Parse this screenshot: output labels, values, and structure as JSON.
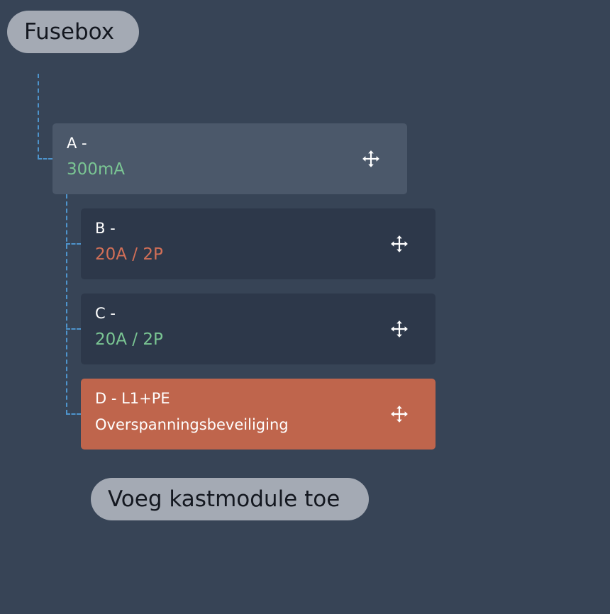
{
  "root": {
    "label": "Fusebox"
  },
  "modules": [
    {
      "title": "A -",
      "subtitle": "300mA",
      "subtitle_color": "#7ac593",
      "background": "#4b586a"
    },
    {
      "title": "B -",
      "subtitle": "20A / 2P",
      "subtitle_color": "#d26f57",
      "background": "#2d384a"
    },
    {
      "title": "C -",
      "subtitle": "20A / 2P",
      "subtitle_color": "#7ac593",
      "background": "#2d384a"
    },
    {
      "title": "D - L1+PE",
      "subtitle": "Overspanningsbeveiliging",
      "subtitle_color": "#ffffff",
      "background": "#bf654c"
    }
  ],
  "add_button": {
    "label": "Voeg kastmodule toe"
  },
  "icons": {
    "move": "move-arrows-icon"
  },
  "colors": {
    "page_background": "#374456",
    "connector": "#4e94cc",
    "pill_background": "#a4aab4"
  }
}
